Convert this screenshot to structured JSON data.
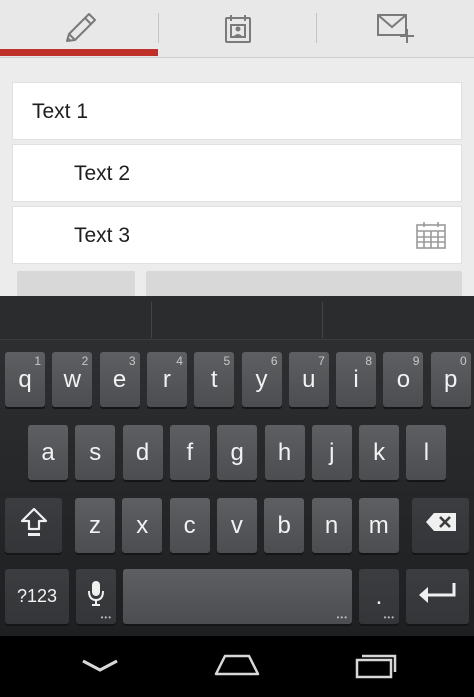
{
  "tabs": [
    {
      "icon": "pencil-icon",
      "selected": true
    },
    {
      "icon": "calendar-contact-icon",
      "selected": false
    },
    {
      "icon": "mail-add-icon",
      "selected": false
    }
  ],
  "colors": {
    "accent": "#c0302b",
    "keyboard_bg": "#2a2c2e",
    "key": "#56585b"
  },
  "rows": [
    {
      "label": "Text 1"
    },
    {
      "label": "Text 2"
    },
    {
      "label": "Text 3",
      "icon": "calendar-icon"
    }
  ],
  "keyboard": {
    "row1": [
      {
        "label": "q",
        "hint": "1"
      },
      {
        "label": "w",
        "hint": "2"
      },
      {
        "label": "e",
        "hint": "3"
      },
      {
        "label": "r",
        "hint": "4"
      },
      {
        "label": "t",
        "hint": "5"
      },
      {
        "label": "y",
        "hint": "6"
      },
      {
        "label": "u",
        "hint": "7"
      },
      {
        "label": "i",
        "hint": "8"
      },
      {
        "label": "o",
        "hint": "9"
      },
      {
        "label": "p",
        "hint": "0"
      }
    ],
    "row2": [
      "a",
      "s",
      "d",
      "f",
      "g",
      "h",
      "j",
      "k",
      "l"
    ],
    "row3": [
      "z",
      "x",
      "c",
      "v",
      "b",
      "n",
      "m"
    ],
    "symbols_label": "?123",
    "period_label": ".",
    "shift_icon": "shift-icon",
    "backspace_icon": "backspace-icon",
    "mic_icon": "microphone-icon",
    "enter_icon": "enter-icon"
  },
  "nav": [
    "back-icon",
    "home-icon",
    "recents-icon"
  ]
}
